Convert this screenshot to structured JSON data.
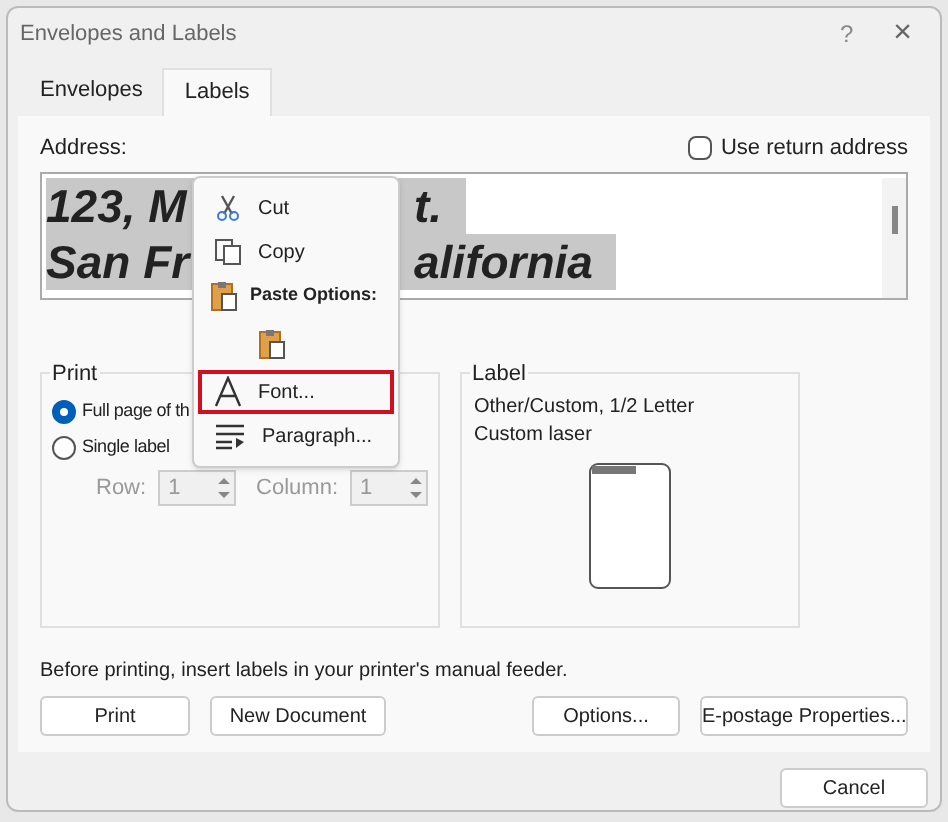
{
  "window": {
    "title": "Envelopes and Labels",
    "help": "?",
    "close": "×"
  },
  "tabs": [
    {
      "label": "Envelopes",
      "selected": false
    },
    {
      "label": "Labels",
      "selected": true
    }
  ],
  "address": {
    "label": "Address:",
    "lines": [
      [
        "123, M",
        "t."
      ],
      [
        "San Fr",
        "alifornia"
      ]
    ]
  },
  "use_return_address": {
    "label": "Use return address",
    "checked": false
  },
  "print_group": {
    "title": "Print",
    "options": [
      {
        "label": "Full page of th",
        "selected": true
      },
      {
        "label": "Single label",
        "selected": false
      }
    ],
    "row": {
      "label": "Row:",
      "value": "1"
    },
    "column": {
      "label": "Column:",
      "value": "1"
    }
  },
  "label_group": {
    "title": "Label",
    "lines": [
      "Other/Custom, 1/2 Letter",
      "Custom laser"
    ]
  },
  "note": "Before printing, insert labels in your printer's manual feeder.",
  "buttons": [
    "Print",
    "New Document",
    "Options...",
    "E-postage Properties..."
  ],
  "cancel": "Cancel",
  "context_menu": {
    "items": [
      {
        "kind": "item",
        "label": "Cut",
        "selected": false
      },
      {
        "kind": "item",
        "label": "Copy",
        "selected": false
      },
      {
        "kind": "header",
        "label": "Paste Options:"
      },
      {
        "kind": "paste"
      },
      {
        "kind": "item",
        "label": "Font...",
        "selected": true
      },
      {
        "kind": "item",
        "label": "Paragraph...",
        "selected": false
      }
    ]
  }
}
